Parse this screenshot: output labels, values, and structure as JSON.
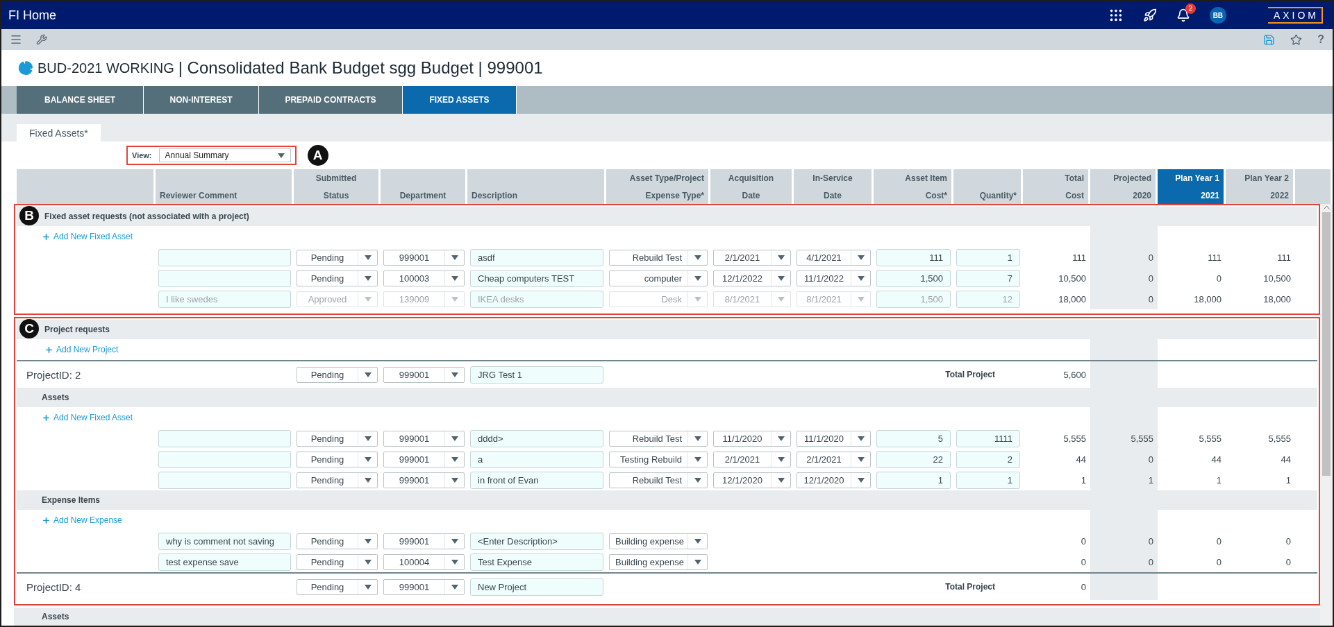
{
  "app": {
    "title": "FI Home",
    "notifications": "2",
    "user_initials": "BB",
    "logo": "AXIOM"
  },
  "toolbar": {
    "help": "?"
  },
  "document": {
    "code": "BUD-2021 WORKING",
    "title": "| Consolidated Bank Budget sgg Budget | 999001"
  },
  "tabs": [
    {
      "label": "BALANCE SHEET",
      "selected": false
    },
    {
      "label": "NON-INTEREST",
      "selected": false
    },
    {
      "label": "PREPAID CONTRACTS",
      "selected": false
    },
    {
      "label": "FIXED ASSETS",
      "selected": true
    }
  ],
  "subtab": {
    "label": "Fixed Assets*",
    "selected": true
  },
  "view": {
    "callout": "A",
    "label": "View:",
    "value": "Annual Summary"
  },
  "columns": [
    {
      "line2": "Reviewer Comment",
      "highlighted": false
    },
    {
      "line1": "Submitted",
      "line2": "Status",
      "highlighted": false
    },
    {
      "line2": "Department",
      "highlighted": false
    },
    {
      "line2": "Description",
      "highlighted": false
    },
    {
      "line1": "Asset Type/Project",
      "line2": "Expense Type*",
      "highlighted": false
    },
    {
      "line1": "Acquisition",
      "line2": "Date",
      "highlighted": false
    },
    {
      "line1": "In-Service",
      "line2": "Date",
      "highlighted": false
    },
    {
      "line1": "Asset Item",
      "line2": "Cost*",
      "highlighted": false
    },
    {
      "line2": "Quantity*",
      "highlighted": false
    },
    {
      "line1": "Total",
      "line2": "Cost",
      "highlighted": false
    },
    {
      "line1": "Projected",
      "line2": "2020",
      "highlighted": false
    },
    {
      "line1": "Plan Year 1",
      "line2": "2021",
      "highlighted": true
    },
    {
      "line1": "Plan Year 2",
      "line2": "2022",
      "highlighted": false
    }
  ],
  "sections": [
    {
      "callout": "B",
      "title": "Fixed asset requests (not associated with a project)",
      "add_link": "Add New Fixed Asset",
      "rows": [
        {
          "kind": "asset",
          "status": "Pending",
          "department": "999001",
          "description": "asdf",
          "type": "Rebuild Test",
          "acquisition_date": "2/1/2021",
          "in_service_date": "4/1/2021",
          "cost": "111",
          "quantity": "1",
          "total": "111",
          "projected": "0",
          "plan_year_1": "111",
          "plan_year_2": "111",
          "disabled": false
        },
        {
          "kind": "asset",
          "status": "Pending",
          "department": "100003",
          "description": "Cheap computers TEST",
          "type": "computer",
          "acquisition_date": "12/1/2022",
          "in_service_date": "11/1/2022",
          "cost": "1,500",
          "quantity": "7",
          "total": "10,500",
          "projected": "0",
          "plan_year_1": "0",
          "plan_year_2": "10,500",
          "disabled": false
        },
        {
          "kind": "asset",
          "comment": "I like swedes",
          "status": "Approved",
          "department": "139009",
          "description": "IKEA desks",
          "type": "Desk",
          "acquisition_date": "8/1/2021",
          "in_service_date": "8/1/2021",
          "cost": "1,500",
          "quantity": "12",
          "total": "18,000",
          "projected": "0",
          "plan_year_1": "18,000",
          "plan_year_2": "18,000",
          "disabled": true
        }
      ]
    },
    {
      "callout": "C",
      "title": "Project requests",
      "add_link": "Add New Project",
      "projects": [
        {
          "label": "ProjectID: 2",
          "status": "Pending",
          "department": "999001",
          "description": "JRG Test 1",
          "total_label": "Total Project",
          "total": "5,600",
          "groups": [
            {
              "title": "Assets",
              "add_link": "Add New Fixed Asset",
              "rows": [
                {
                  "kind": "asset",
                  "status": "Pending",
                  "department": "999001",
                  "description": "dddd>",
                  "type": "Rebuild Test",
                  "acquisition_date": "11/1/2020",
                  "in_service_date": "11/1/2020",
                  "cost": "5",
                  "quantity": "1111",
                  "total": "5,555",
                  "projected": "5,555",
                  "plan_year_1": "5,555",
                  "plan_year_2": "5,555",
                  "disabled": false
                },
                {
                  "kind": "asset",
                  "status": "Pending",
                  "department": "999001",
                  "description": "a",
                  "type": "Testing Rebuild",
                  "acquisition_date": "2/1/2021",
                  "in_service_date": "2/1/2021",
                  "cost": "22",
                  "quantity": "2",
                  "total": "44",
                  "projected": "0",
                  "plan_year_1": "44",
                  "plan_year_2": "44",
                  "disabled": false
                },
                {
                  "kind": "asset",
                  "status": "Pending",
                  "department": "999001",
                  "description": "in front of Evan",
                  "type": "Rebuild Test",
                  "acquisition_date": "12/1/2020",
                  "in_service_date": "12/1/2020",
                  "cost": "1",
                  "quantity": "1",
                  "total": "1",
                  "projected": "1",
                  "plan_year_1": "1",
                  "plan_year_2": "1",
                  "disabled": false
                }
              ]
            },
            {
              "title": "Expense Items",
              "add_link": "Add New Expense",
              "rows": [
                {
                  "kind": "expense",
                  "comment": "why is comment not saving",
                  "status": "Pending",
                  "department": "999001",
                  "description": "<Enter Description>",
                  "type": "Building expense",
                  "total": "0",
                  "projected": "0",
                  "plan_year_1": "0",
                  "plan_year_2": "0",
                  "disabled": false
                },
                {
                  "kind": "expense",
                  "comment": "test expense save",
                  "status": "Pending",
                  "department": "100004",
                  "description": "Test Expense",
                  "type": "Building expense",
                  "total": "0",
                  "projected": "0",
                  "plan_year_1": "0",
                  "plan_year_2": "0",
                  "disabled": false
                }
              ]
            }
          ]
        },
        {
          "label": "ProjectID: 4",
          "status": "Pending",
          "department": "999001",
          "description": "New Project",
          "total_label": "Total Project",
          "total": "0"
        }
      ]
    }
  ],
  "trailing_group": {
    "title": "Assets"
  }
}
